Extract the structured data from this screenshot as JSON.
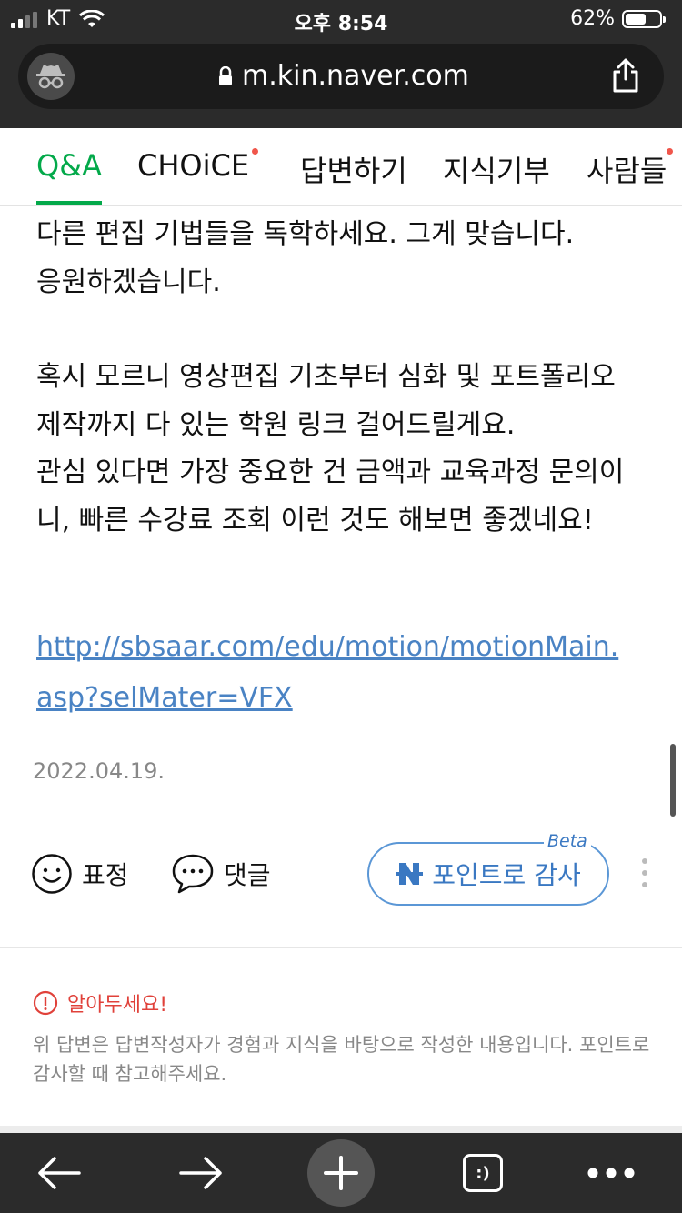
{
  "status_bar": {
    "carrier": "KT",
    "time": "오후 8:54",
    "battery": "62%",
    "battery_level": 0.62
  },
  "browser": {
    "url": "m.kin.naver.com",
    "secure": true
  },
  "tabs": [
    {
      "label": "Q&A",
      "active": true,
      "new_dot": false
    },
    {
      "label": "CHOiCE",
      "active": false,
      "new_dot": true
    },
    {
      "label": "답변하기",
      "active": false,
      "new_dot": false
    },
    {
      "label": "지식기부",
      "active": false,
      "new_dot": false
    },
    {
      "label": "사람들",
      "active": false,
      "new_dot": true
    }
  ],
  "answer": {
    "paragraph1": [
      "다른 편집 기법들을 독학하세요. 그게 맞습니다.",
      "응원하겠습니다."
    ],
    "paragraph2": [
      "혹시 모르니 영상편집 기초부터 심화 및 포트폴리오",
      "제작까지 다 있는 학원 링크 걸어드릴게요.",
      "관심 있다면 가장 중요한 건 금액과 교육과정 문의이",
      "니, 빠른 수강료 조회 이런 것도 해보면 좋겠네요!"
    ],
    "link_lines": [
      "http://sbsaar.com/edu/motion/motionMain.",
      "asp?selMater=VFX"
    ],
    "date": "2022.04.19."
  },
  "actions": {
    "emotion_label": "표정",
    "comment_label": "댓글",
    "point_label": "포인트로 감사",
    "beta_label": "Beta"
  },
  "notice": {
    "title": "알아두세요!",
    "body": "위 답변은 답변작성자가 경험과 지식을 바탕으로 작성한 내용입니다. 포인트로 감사할 때 참고해주세요."
  },
  "colors": {
    "accent_green": "#03a94a",
    "link_blue": "#4a83c4",
    "alert_red": "#e0413a",
    "chrome_dark": "#2b2b2b"
  },
  "toolbar": {
    "tab_icon_label": ":)"
  }
}
